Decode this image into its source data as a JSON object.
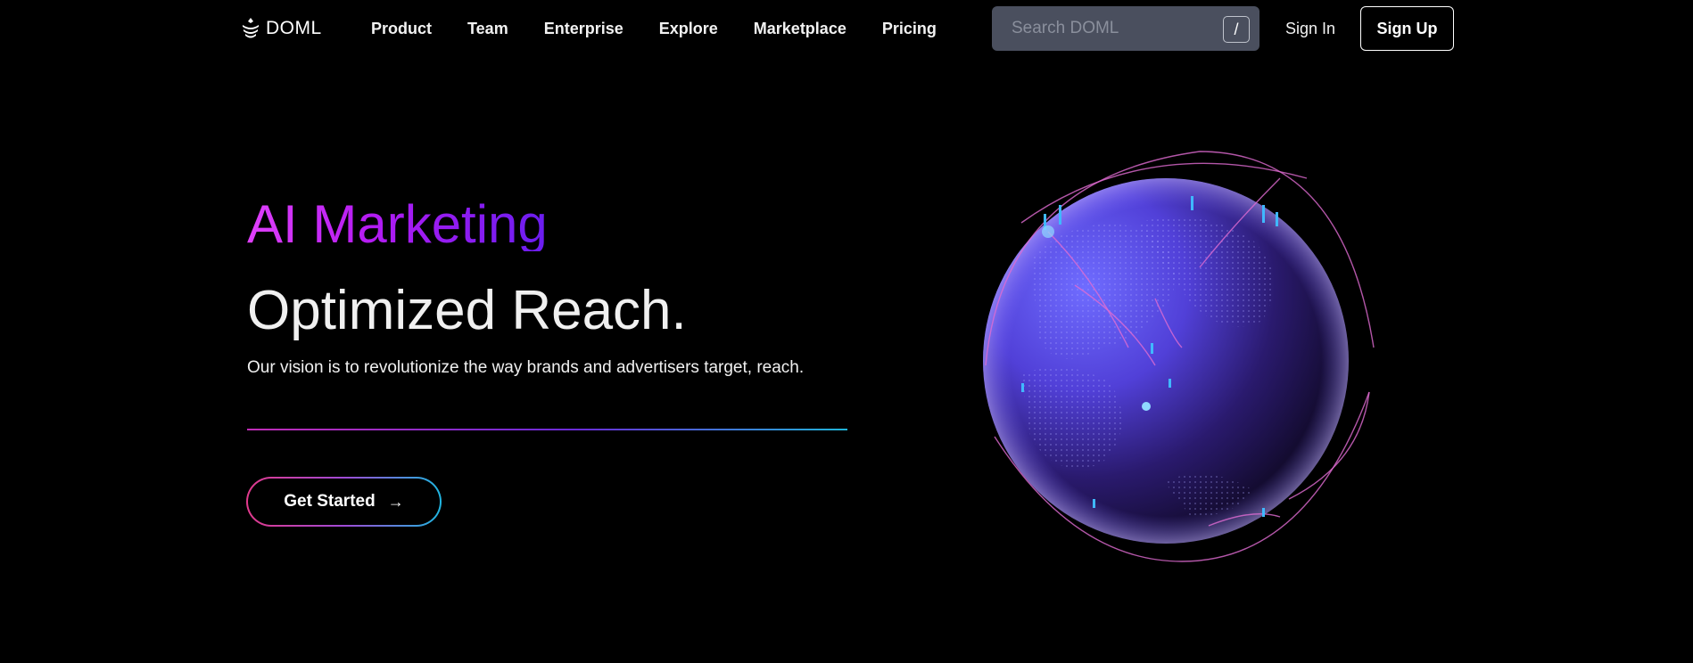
{
  "nav": {
    "logo_text": "DOML",
    "links": [
      "Product",
      "Team",
      "Enterprise",
      "Explore",
      "Marketplace",
      "Pricing"
    ],
    "search_placeholder": "Search DOML",
    "search_shortcut": "/",
    "sign_in": "Sign In",
    "sign_up": "Sign Up"
  },
  "hero": {
    "eyebrow": "AI Marketing",
    "headline": "Optimized Reach.",
    "subtext": "Our vision is to revolutionize the way brands and advertisers target, reach.",
    "cta_label": "Get Started",
    "cta_icon": "arrow-right-icon"
  },
  "colors": {
    "background": "#000000",
    "accent_pink": "#e040fb",
    "accent_purple": "#6a1df0",
    "accent_cyan": "#1fb6e0",
    "search_bg": "#4a4f5e"
  }
}
